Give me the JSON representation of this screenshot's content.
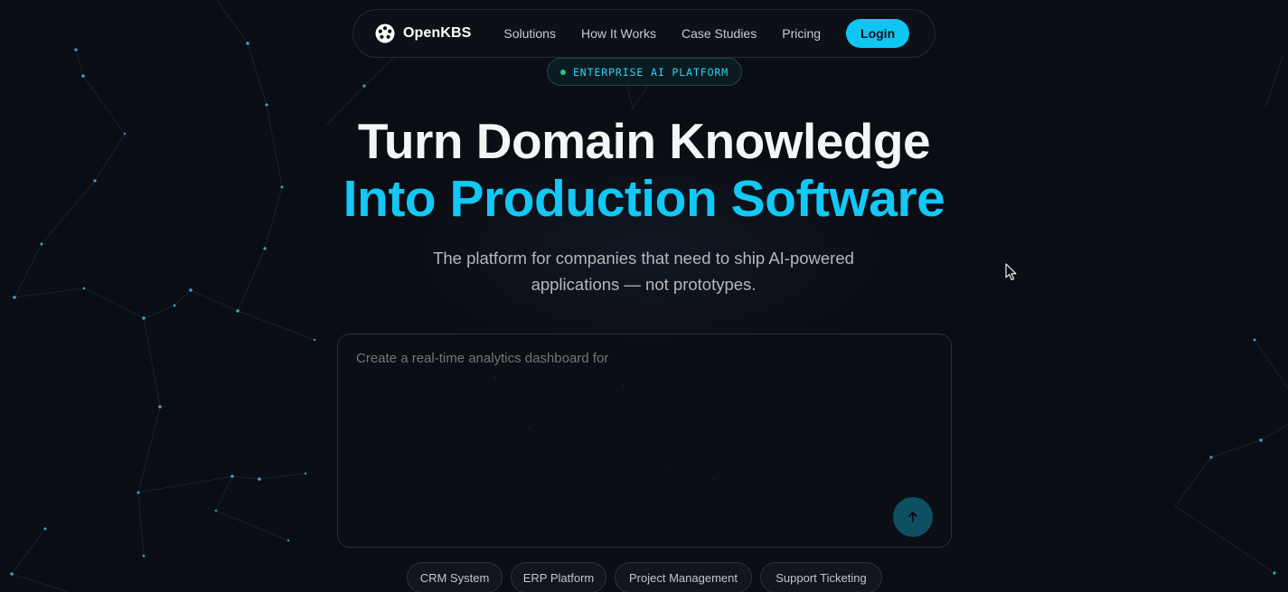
{
  "nav": {
    "brand": "OpenKBS",
    "links": [
      "Solutions",
      "How It Works",
      "Case Studies",
      "Pricing"
    ],
    "login_label": "Login"
  },
  "badge": {
    "text": "ENTERPRISE AI PLATFORM"
  },
  "hero": {
    "headline_line1": "Turn Domain Knowledge",
    "headline_line2": "Into Production Software",
    "subtitle_line1": "The platform for companies that need to ship AI-powered",
    "subtitle_line2": "applications — not prototypes."
  },
  "prompt": {
    "placeholder": "Create a real-time analytics dashboard for",
    "send_icon": "arrow-up-icon"
  },
  "chips": [
    "CRM System",
    "ERP Platform",
    "Project Management",
    "Support Ticketing"
  ],
  "colors": {
    "background": "#0b0d14",
    "accent": "#12c8f4",
    "login_button": "#0fc6f2",
    "send_button": "#0f4f63",
    "badge_dot": "#1ec98a"
  }
}
